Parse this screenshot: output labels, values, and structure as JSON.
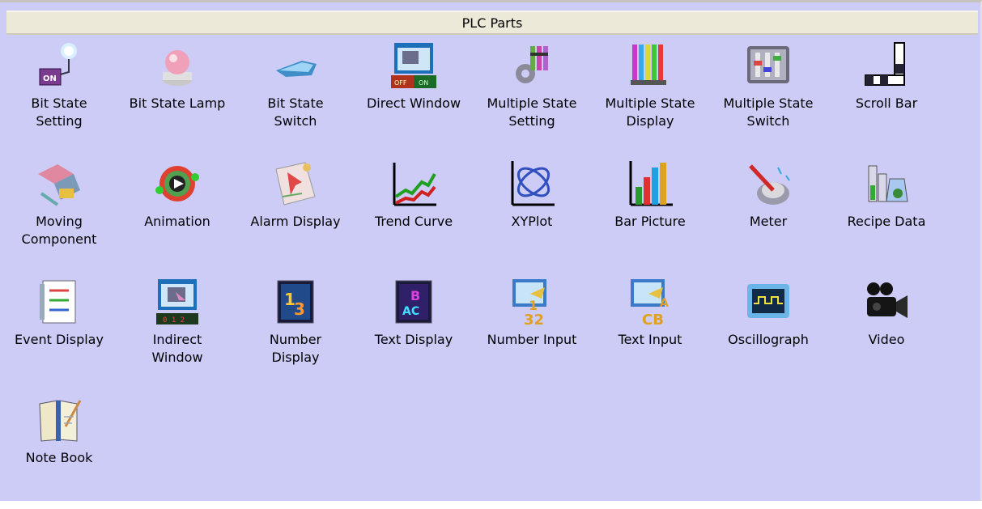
{
  "panel": {
    "title": "PLC Parts"
  },
  "items": [
    {
      "label": "Bit State\nSetting",
      "icon": "bit-state-setting-icon"
    },
    {
      "label": "Bit State Lamp",
      "icon": "lamp-icon"
    },
    {
      "label": "Bit State\nSwitch",
      "icon": "switch-icon"
    },
    {
      "label": "Direct Window",
      "icon": "direct-window-icon"
    },
    {
      "label": "Multiple State\nSetting",
      "icon": "multi-state-setting-icon"
    },
    {
      "label": "Multiple State\nDisplay",
      "icon": "multi-state-display-icon"
    },
    {
      "label": "Multiple State\nSwitch",
      "icon": "multi-state-switch-icon"
    },
    {
      "label": "Scroll Bar",
      "icon": "scroll-bar-icon"
    },
    {
      "label": "Moving\nComponent",
      "icon": "moving-component-icon"
    },
    {
      "label": "Animation",
      "icon": "animation-icon"
    },
    {
      "label": "Alarm Display",
      "icon": "alarm-display-icon"
    },
    {
      "label": "Trend Curve",
      "icon": "trend-curve-icon"
    },
    {
      "label": "XYPlot",
      "icon": "xyplot-icon"
    },
    {
      "label": "Bar Picture",
      "icon": "bar-picture-icon"
    },
    {
      "label": "Meter",
      "icon": "meter-icon"
    },
    {
      "label": "Recipe Data",
      "icon": "recipe-data-icon"
    },
    {
      "label": "Event Display",
      "icon": "event-display-icon"
    },
    {
      "label": "Indirect\nWindow",
      "icon": "indirect-window-icon"
    },
    {
      "label": "Number\nDisplay",
      "icon": "number-display-icon"
    },
    {
      "label": "Text Display",
      "icon": "text-display-icon"
    },
    {
      "label": "Number Input",
      "icon": "number-input-icon"
    },
    {
      "label": "Text Input",
      "icon": "text-input-icon"
    },
    {
      "label": "Oscillograph",
      "icon": "oscillograph-icon"
    },
    {
      "label": "Video",
      "icon": "video-camera-icon"
    },
    {
      "label": "Note Book",
      "icon": "notebook-icon"
    }
  ]
}
